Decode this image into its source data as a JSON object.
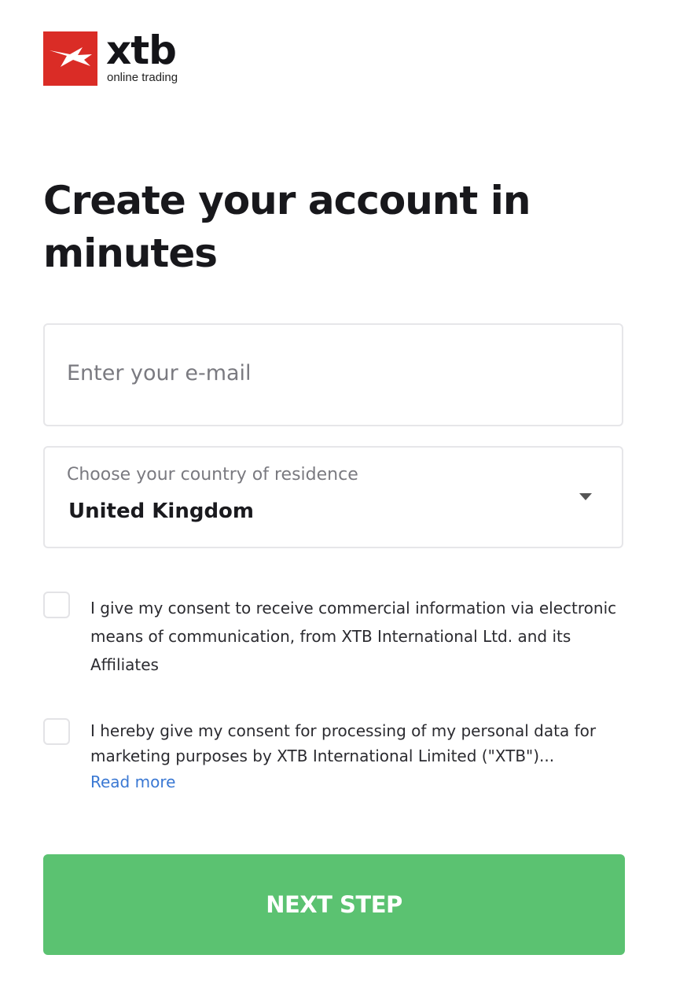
{
  "brand": {
    "icon": "xtb-logo-icon",
    "name": "xtb",
    "tagline": "online trading",
    "color": "#da2c26"
  },
  "page": {
    "title": "Create your account in minutes"
  },
  "form": {
    "email": {
      "placeholder": "Enter your e-mail",
      "value": ""
    },
    "country": {
      "label": "Choose your country of residence",
      "selected": "United Kingdom",
      "icon": "dropdown-caret-icon"
    },
    "consents": [
      {
        "checked": false,
        "text": "I give my consent to receive commercial information via electronic means of communication, from XTB International Ltd. and its Affiliates"
      },
      {
        "checked": false,
        "text": "I hereby give my consent for processing of my personal data for marketing purposes by XTB International Limited (\"XTB\")...",
        "link": "Read more"
      }
    ],
    "submit_label": "NEXT STEP"
  },
  "colors": {
    "accent_green": "#5bc271",
    "link_blue": "#3a78d3",
    "text": "#1d1d22",
    "muted": "#7a7a80"
  }
}
